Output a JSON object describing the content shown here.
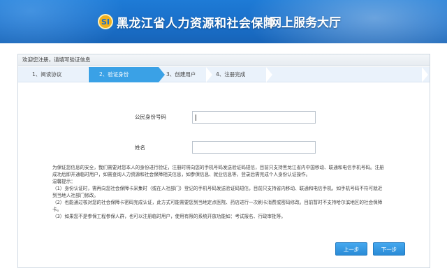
{
  "banner": {
    "logo_letter": "SI",
    "title_main": "黑龙江省人力资源和社会保障",
    "title_sub": "网上服务大厅"
  },
  "panel": {
    "header": "欢迎您注册，请填写验证信息"
  },
  "steps": [
    {
      "label": "1、阅读协议",
      "active": false
    },
    {
      "label": "2、验证身份",
      "active": true
    },
    {
      "label": "3、创建用户",
      "active": false
    },
    {
      "label": "4、注册完成",
      "active": false
    }
  ],
  "form": {
    "id_label": "公民身份号码",
    "id_value": "",
    "name_label": "姓名",
    "name_value": ""
  },
  "notice": {
    "para1": "为保证您信息的安全，我们需要对您本人的身份进行验证，注册时将向您的手机号码发送验证码短信，目前只支持黑龙江省内中国移动、联通和电信手机号码。注册成功后即开通临时用户，如需查询人力资源和社会保障相关信息，如参保信息、就业信息等，登录后需完成个人身份认证操作。",
    "tip_title": "温馨提示：",
    "tip1": "（1）身份认证时，需再向您社会保障卡采集时（或在人社部门）登记的手机号码发送验证码短信，目前只支持省内移动、联通和电信手机，如手机号码不符可就近到当地人社部门修改。",
    "tip2": "（2）也能通过核对您的社会保障卡密码完成认证，此方式可能需要您到当地定点医院、药店进行一次刷卡消费或密码修改。目前暂时不支持哈尔滨地区的社会保障卡。",
    "tip3": "（3）如果您不是参保工程参保人群，也可以注册临时用户，使用有限的系统开放功能如：考试报名、行政审批等。"
  },
  "buttons": {
    "prev": "上一步",
    "next": "下一步"
  },
  "colors": {
    "banner": "#1a6fc9",
    "step_active": "#3aa1e6",
    "button": "#2a8bd6"
  }
}
